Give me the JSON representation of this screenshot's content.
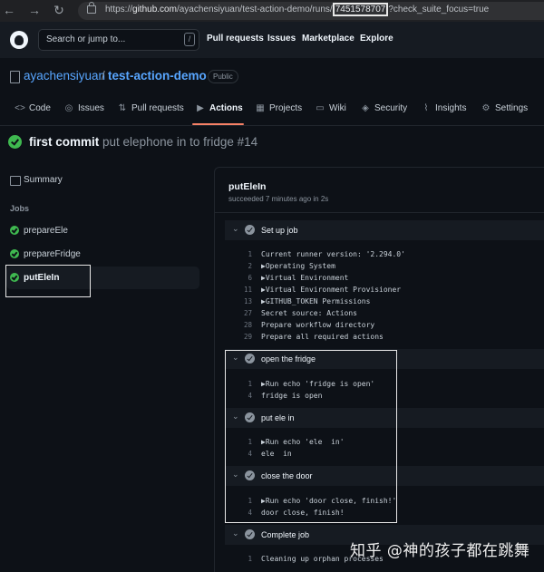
{
  "browser": {
    "url_prefix": "https://",
    "url_domain": "github.com",
    "url_path": "/ayachensiyuan/test-action-demo/runs/",
    "url_run_id": "7451578707",
    "url_query": "?check_suite_focus=true"
  },
  "header": {
    "search_placeholder": "Search or jump to...",
    "search_key": "/",
    "nav": [
      "Pull requests",
      "Issues",
      "Marketplace",
      "Explore"
    ]
  },
  "repo": {
    "owner": "ayachensiyuan",
    "separator": "/",
    "name": "test-action-demo",
    "visibility": "Public"
  },
  "tabs": [
    {
      "label": "Code",
      "icon": "<>"
    },
    {
      "label": "Issues",
      "icon": "◎"
    },
    {
      "label": "Pull requests",
      "icon": "⇅"
    },
    {
      "label": "Actions",
      "icon": "▶"
    },
    {
      "label": "Projects",
      "icon": "▦"
    },
    {
      "label": "Wiki",
      "icon": "▭"
    },
    {
      "label": "Security",
      "icon": "◈"
    },
    {
      "label": "Insights",
      "icon": "⌇"
    },
    {
      "label": "Settings",
      "icon": "⚙"
    }
  ],
  "run": {
    "title": "first commit",
    "message": "put elephone in to fridge #14"
  },
  "sidebar": {
    "summary": "Summary",
    "jobs_label": "Jobs",
    "jobs": [
      "prepareEle",
      "prepareFridge",
      "putEleIn"
    ]
  },
  "job": {
    "name": "putEleIn",
    "status": "succeeded 7 minutes ago in 2s",
    "steps": [
      {
        "name": "Set up job",
        "lines": [
          {
            "n": "1",
            "t": "Current runner version: '2.294.0'"
          },
          {
            "n": "2",
            "t": "▶Operating System"
          },
          {
            "n": "6",
            "t": "▶Virtual Environment"
          },
          {
            "n": "11",
            "t": "▶Virtual Environment Provisioner"
          },
          {
            "n": "13",
            "t": "▶GITHUB_TOKEN Permissions"
          },
          {
            "n": "27",
            "t": "Secret source: Actions"
          },
          {
            "n": "28",
            "t": "Prepare workflow directory"
          },
          {
            "n": "29",
            "t": "Prepare all required actions"
          }
        ]
      },
      {
        "name": "open the fridge",
        "lines": [
          {
            "n": "1",
            "t": "▶Run echo 'fridge is open'"
          },
          {
            "n": "4",
            "t": "fridge is open"
          }
        ]
      },
      {
        "name": "put ele in",
        "lines": [
          {
            "n": "1",
            "t": "▶Run echo 'ele  in'"
          },
          {
            "n": "4",
            "t": "ele  in"
          }
        ]
      },
      {
        "name": "close the door",
        "lines": [
          {
            "n": "1",
            "t": "▶Run echo 'door close, finish!'"
          },
          {
            "n": "4",
            "t": "door close, finish!"
          }
        ]
      },
      {
        "name": "Complete job",
        "lines": [
          {
            "n": "1",
            "t": "Cleaning up orphan processes"
          }
        ]
      }
    ]
  },
  "watermark": "知乎 @神的孩子都在跳舞",
  "colors": {
    "accent_blue": "#58a6ff",
    "success_green": "#3fb950",
    "tab_underline": "#f78166"
  }
}
